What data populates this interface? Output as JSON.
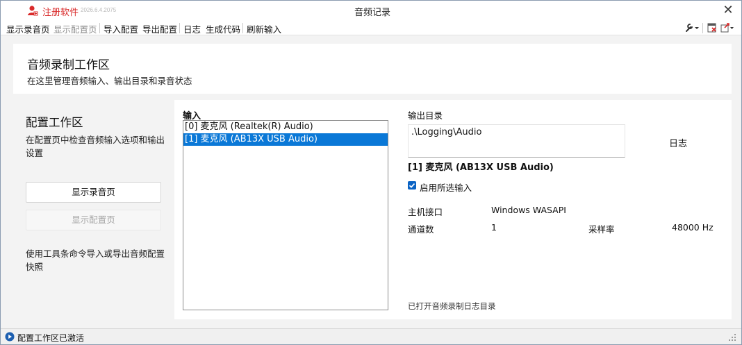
{
  "titlebar": {
    "register_label": "注册软件",
    "register_date": "2026.6.4.2075",
    "title": "音频记录",
    "close_glyph": "✕"
  },
  "toolbar": {
    "items": [
      {
        "label": "显示录音页",
        "enabled": true
      },
      {
        "label": "显示配置页",
        "enabled": false
      },
      {
        "label": "导入配置",
        "enabled": true
      },
      {
        "label": "导出配置",
        "enabled": true
      },
      {
        "label": "日志",
        "enabled": true
      },
      {
        "label": "生成代码",
        "enabled": true
      },
      {
        "label": "刷新输入",
        "enabled": true
      }
    ],
    "right_icons": [
      "wrench-dropdown-icon",
      "clear-log-icon",
      "export-dropdown-icon"
    ]
  },
  "header": {
    "title": "音频录制工作区",
    "subtitle": "在这里管理音频输入、输出目录和录音状态"
  },
  "left": {
    "title": "配置工作区",
    "description": "在配置页中检查音频输入选项和输出设置",
    "show_record_button": "显示录音页",
    "show_config_button": "显示配置页",
    "note": "使用工具条命令导入或导出音频配置快照"
  },
  "inputs": {
    "label": "输入",
    "items": [
      {
        "label": "[0] 麦克风 (Realtek(R) Audio)",
        "selected": false
      },
      {
        "label": "[1] 麦克风 (AB13X USB Audio)",
        "selected": true
      }
    ]
  },
  "output": {
    "label": "输出目录",
    "path": ".\\Logging\\Audio",
    "log_label": "日志",
    "device_name": "[1] 麦克风 (AB13X USB Audio)",
    "enable_label": "启用所选输入",
    "enable_checked": true,
    "host_api_label": "主机接口",
    "host_api_value": "Windows WASAPI",
    "channels_label": "通道数",
    "channels_value": "1",
    "sample_rate_label": "采样率",
    "sample_rate_value": "48000 Hz",
    "status_note": "已打开音频录制日志目录"
  },
  "statusbar": {
    "text": "配置工作区已激活"
  },
  "colors": {
    "accent": "#0a78d7",
    "register": "#d92b2b",
    "window_bg": "#f3f3f3"
  }
}
